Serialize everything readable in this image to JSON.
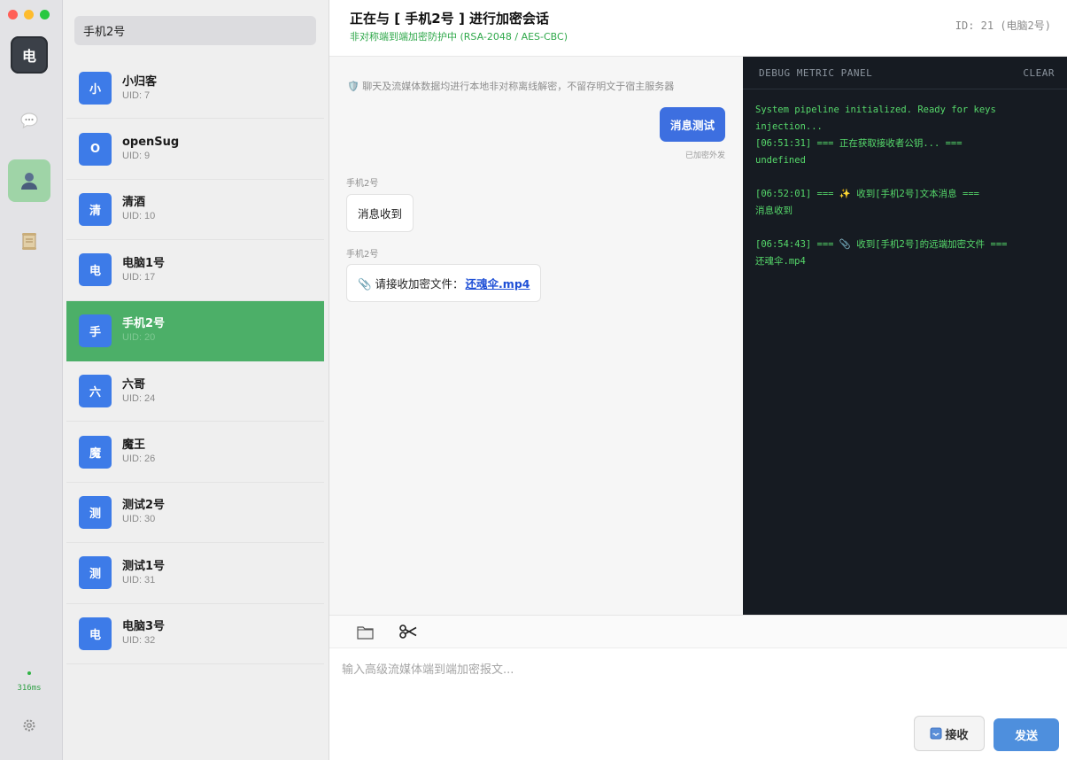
{
  "rail": {
    "avatar_text": "电",
    "latency": "316ms",
    "status_color": "#2fb344"
  },
  "search": {
    "value": "手机2号"
  },
  "contacts": [
    {
      "avatar": "小",
      "name": "小归客",
      "uid": "UID: 7"
    },
    {
      "avatar": "O",
      "name": "openSug",
      "uid": "UID: 9"
    },
    {
      "avatar": "清",
      "name": "清酒",
      "uid": "UID: 10"
    },
    {
      "avatar": "电",
      "name": "电脑1号",
      "uid": "UID: 17"
    },
    {
      "avatar": "手",
      "name": "手机2号",
      "uid": "UID: 20",
      "active": true
    },
    {
      "avatar": "六",
      "name": "六哥",
      "uid": "UID: 24"
    },
    {
      "avatar": "魔",
      "name": "魔王",
      "uid": "UID: 26"
    },
    {
      "avatar": "测",
      "name": "测试2号",
      "uid": "UID: 30"
    },
    {
      "avatar": "测",
      "name": "测试1号",
      "uid": "UID: 31"
    },
    {
      "avatar": "电",
      "name": "电脑3号",
      "uid": "UID: 32"
    }
  ],
  "header": {
    "title": "正在与 [ 手机2号 ] 进行加密会话",
    "subtitle": "非对称端到端加密防护中 (RSA-2048 / AES-CBC)",
    "id_label": "ID: 21 (电脑2号)"
  },
  "chat": {
    "notice": "🛡️ 聊天及流媒体数据均进行本地非对称离线解密，不留存明文于宿主服务器",
    "outgoing": {
      "text": "消息测试",
      "status": "已加密外发"
    },
    "incoming": [
      {
        "sender": "手机2号",
        "text": "消息收到"
      },
      {
        "sender": "手机2号",
        "prefix": "📎 请接收加密文件：",
        "file": "还魂伞.mp4"
      }
    ]
  },
  "debug": {
    "title": "DEBUG METRIC PANEL",
    "clear": "CLEAR",
    "logs": [
      "System pipeline initialized. Ready for keys injection...\n[06:51:31] === 正在获取接收者公钥... ===\nundefined",
      "[06:52:01] === ✨ 收到[手机2号]文本消息 ===\n消息收到",
      "[06:54:43] === 📎 收到[手机2号]的远端加密文件 ===\n还魂伞.mp4"
    ]
  },
  "composer": {
    "placeholder": "输入高级流媒体端到端加密报文...",
    "receive_label": "接收",
    "send_label": "发送"
  },
  "icons": {
    "rail_chat": "chat-bubble-icon",
    "rail_contacts": "user-icon",
    "rail_scroll": "scroll-icon",
    "rail_settings": "gear-icon",
    "toolbar_folder": "folder-icon",
    "toolbar_scissors": "scissors-icon",
    "receive": "inbox-icon"
  },
  "colors": {
    "accent_green": "#4caf68",
    "accent_blue": "#3d6fe0",
    "avatar_blue": "#3d7be8",
    "debug_bg": "#161b22",
    "debug_text": "#56d96b"
  }
}
